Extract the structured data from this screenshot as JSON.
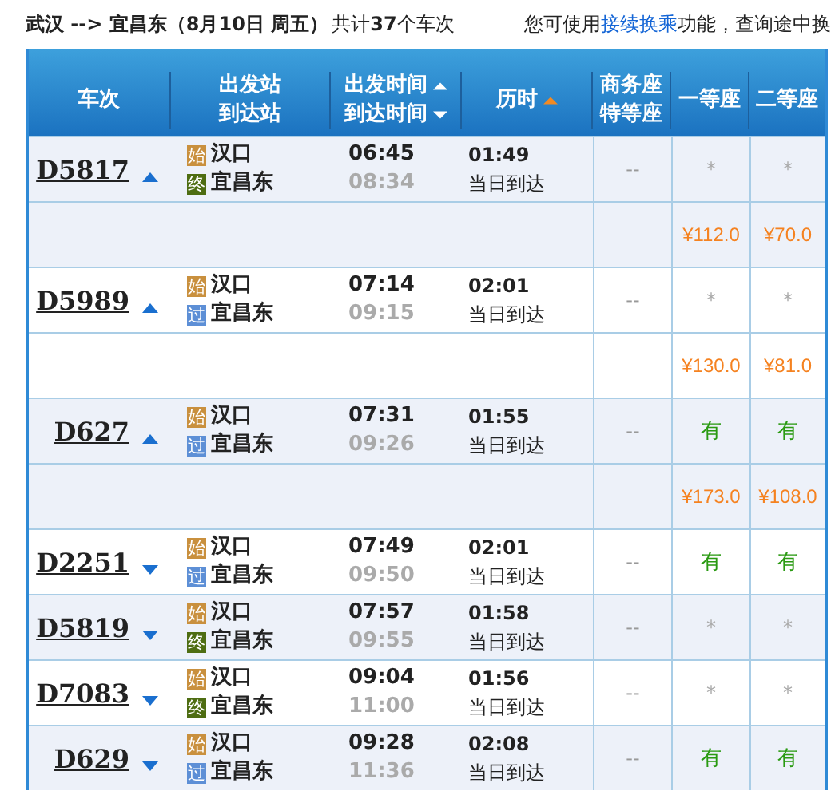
{
  "summary": {
    "route": "武汉 --> 宜昌东（8月10日  周五）",
    "count": "共计**37**个车次",
    "hint_before": "您可使用",
    "hint_link": "接续换乘",
    "hint_after": "功能，查询途中换"
  },
  "columns": [
    {
      "lines": [
        {
          "text": "车次"
        }
      ]
    },
    {
      "lines": [
        {
          "text": "出发站"
        },
        {
          "text": "到达站"
        }
      ]
    },
    {
      "lines": [
        {
          "text": "出发时间",
          "ascending": true,
          "active": false
        },
        {
          "text": "到达时间",
          "ascending": false,
          "active": false
        }
      ]
    },
    {
      "lines": [
        {
          "text": "历时",
          "ascending": true,
          "active": true
        }
      ]
    },
    {
      "lines": [
        {
          "text": "商务座"
        },
        {
          "text": "特等座"
        }
      ]
    },
    {
      "lines": [
        {
          "text": "一等座"
        }
      ]
    },
    {
      "lines": [
        {
          "text": "二等座"
        }
      ]
    }
  ],
  "trains": [
    {
      "number": "D5817",
      "expanded": true,
      "from": {
        "badge": "始",
        "kind": "start",
        "name": "汉口"
      },
      "to": {
        "badge": "终",
        "kind": "end",
        "name": "宜昌东"
      },
      "depart": "06:45",
      "arrive": "08:34",
      "duration": "01:49",
      "note": "当日到达",
      "seats": [
        {
          "text": "--",
          "kind": "none"
        },
        {
          "text": "*",
          "kind": "unknown"
        },
        {
          "text": "*",
          "kind": "unknown"
        }
      ],
      "prices": [
        "¥112.0",
        "¥70.0"
      ]
    },
    {
      "number": "D5989",
      "expanded": true,
      "from": {
        "badge": "始",
        "kind": "start",
        "name": "汉口"
      },
      "to": {
        "badge": "过",
        "kind": "pass",
        "name": "宜昌东"
      },
      "depart": "07:14",
      "arrive": "09:15",
      "duration": "02:01",
      "note": "当日到达",
      "seats": [
        {
          "text": "--",
          "kind": "none"
        },
        {
          "text": "*",
          "kind": "unknown"
        },
        {
          "text": "*",
          "kind": "unknown"
        }
      ],
      "prices": [
        "¥130.0",
        "¥81.0"
      ]
    },
    {
      "number": "D627",
      "expanded": true,
      "from": {
        "badge": "始",
        "kind": "start",
        "name": "汉口"
      },
      "to": {
        "badge": "过",
        "kind": "pass",
        "name": "宜昌东"
      },
      "depart": "07:31",
      "arrive": "09:26",
      "duration": "01:55",
      "note": "当日到达",
      "seats": [
        {
          "text": "--",
          "kind": "none"
        },
        {
          "text": "有",
          "kind": "available"
        },
        {
          "text": "有",
          "kind": "available"
        }
      ],
      "prices": [
        "¥173.0",
        "¥108.0"
      ]
    },
    {
      "number": "D2251",
      "expanded": false,
      "from": {
        "badge": "始",
        "kind": "start",
        "name": "汉口"
      },
      "to": {
        "badge": "过",
        "kind": "pass",
        "name": "宜昌东"
      },
      "depart": "07:49",
      "arrive": "09:50",
      "duration": "02:01",
      "note": "当日到达",
      "seats": [
        {
          "text": "--",
          "kind": "none"
        },
        {
          "text": "有",
          "kind": "available"
        },
        {
          "text": "有",
          "kind": "available"
        }
      ]
    },
    {
      "number": "D5819",
      "expanded": false,
      "from": {
        "badge": "始",
        "kind": "start",
        "name": "汉口"
      },
      "to": {
        "badge": "终",
        "kind": "end",
        "name": "宜昌东"
      },
      "depart": "07:57",
      "arrive": "09:55",
      "duration": "01:58",
      "note": "当日到达",
      "seats": [
        {
          "text": "--",
          "kind": "none"
        },
        {
          "text": "*",
          "kind": "unknown"
        },
        {
          "text": "*",
          "kind": "unknown"
        }
      ]
    },
    {
      "number": "D7083",
      "expanded": false,
      "from": {
        "badge": "始",
        "kind": "start",
        "name": "汉口"
      },
      "to": {
        "badge": "终",
        "kind": "end",
        "name": "宜昌东"
      },
      "depart": "09:04",
      "arrive": "11:00",
      "duration": "01:56",
      "note": "当日到达",
      "seats": [
        {
          "text": "--",
          "kind": "none"
        },
        {
          "text": "*",
          "kind": "unknown"
        },
        {
          "text": "*",
          "kind": "unknown"
        }
      ]
    },
    {
      "number": "D629",
      "expanded": false,
      "from": {
        "badge": "始",
        "kind": "start",
        "name": "汉口"
      },
      "to": {
        "badge": "过",
        "kind": "pass",
        "name": "宜昌东"
      },
      "depart": "09:28",
      "arrive": "11:36",
      "duration": "02:08",
      "note": "当日到达",
      "seats": [
        {
          "text": "--",
          "kind": "none"
        },
        {
          "text": "有",
          "kind": "available"
        },
        {
          "text": "有",
          "kind": "available"
        }
      ]
    }
  ]
}
